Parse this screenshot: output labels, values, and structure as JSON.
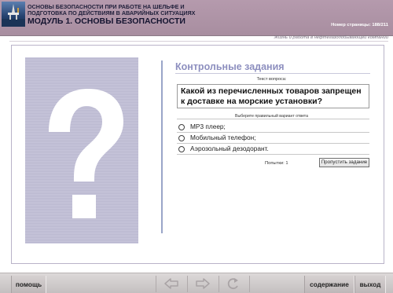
{
  "header": {
    "title_line1": "ОСНОВЫ БЕЗОПАСНОСТИ ПРИ РАБОТЕ НА ШЕЛЬФЕ И",
    "title_line2": "ПОДГОТОВКА ПО ДЕЙСТВИЯМ В АВАРИЙНЫХ СИТУАЦИЯХ",
    "module_title": "МОДУЛЬ 1. ОСНОВЫ БЕЗОПАСНОСТИ",
    "page_number": "Номер страницы: 188/211",
    "logo_icon": "oil-platform-icon"
  },
  "subtitle": "Жизнь и работа в нефтегазодобывающей компании",
  "main": {
    "image_icon": "question-mark-icon",
    "section_title": "Контрольные задания",
    "question_label": "Текст вопроса:",
    "question_text": "Какой из перечисленных товаров запрещен к доставке на морские установки?",
    "answer_label": "Выберите правильный вариант ответа",
    "options": [
      {
        "label": "МР3 плеер;",
        "selected": false
      },
      {
        "label": "Мобильный телефон;",
        "selected": false
      },
      {
        "label": "Аэрозольный дезодорант.",
        "selected": false
      }
    ],
    "attempts": "Попытки: 1",
    "skip_button": "Пропустить задание"
  },
  "footer": {
    "help": "помощь",
    "contents": "содержание",
    "exit": "выход",
    "nav_icons": [
      "back-arrow-icon",
      "forward-arrow-icon",
      "reload-icon"
    ]
  },
  "colors": {
    "header_bg": "#b59aad",
    "accent_title": "#8d8fbf",
    "frame_border": "#b9b3c8",
    "footer_bg": "#ccc7c8"
  }
}
